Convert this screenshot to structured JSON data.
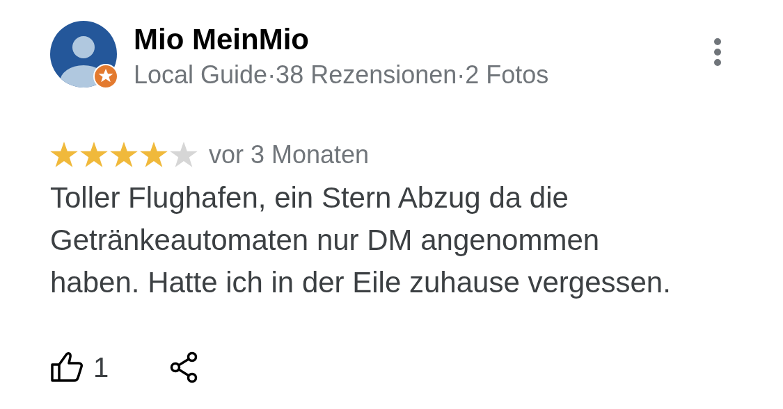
{
  "review": {
    "author": "Mio MeinMio",
    "meta": "Local Guide·38 Rezensionen·2 Fotos",
    "local_guide": true,
    "stars": 4,
    "time": "vor 3 Monaten",
    "text": "Toller Flughafen, ein Stern Abzug da die Getränkeautomaten nur DM angenommen haben. Hatte ich in der Eile zuhause vergessen.",
    "likes": "1"
  }
}
